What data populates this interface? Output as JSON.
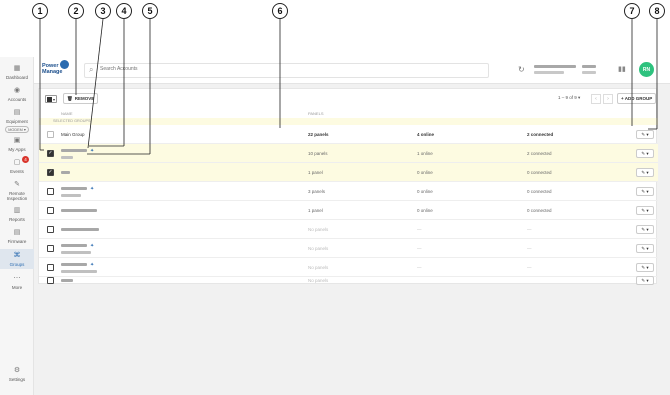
{
  "callouts": [
    "1",
    "2",
    "3",
    "4",
    "5",
    "6",
    "7",
    "8"
  ],
  "sidebar": {
    "items": [
      {
        "label": "Dashboard",
        "icon": "dashboard-icon",
        "glyph": "▦"
      },
      {
        "label": "Accounts",
        "icon": "accounts-icon",
        "glyph": "👥"
      },
      {
        "label": "Equipment",
        "icon": "equipment-icon",
        "glyph": "▤",
        "pill": "MODEM ▾"
      },
      {
        "label": "My Apps",
        "icon": "apps-icon",
        "glyph": "▣"
      },
      {
        "label": "Events",
        "icon": "events-icon",
        "glyph": "▢",
        "badge": "4"
      },
      {
        "label": "Remote Inspection",
        "icon": "wrench-icon",
        "glyph": "✎"
      },
      {
        "label": "Reports",
        "icon": "reports-icon",
        "glyph": "▥"
      },
      {
        "label": "Firmware",
        "icon": "firmware-icon",
        "glyph": "▤"
      },
      {
        "label": "Groups",
        "icon": "groups-icon",
        "glyph": "⌘",
        "active": true
      },
      {
        "label": "More",
        "icon": "more-icon",
        "glyph": "⋯"
      }
    ],
    "settings": "Settings"
  },
  "header": {
    "logo_line1": "Power",
    "logo_line2": "Manage",
    "search_placeholder": "Search Accounts",
    "avatar_initials": "RN"
  },
  "toolbar": {
    "remove_label": "REMOVE",
    "pager_text": "1 – 9 of 9 ▾",
    "add_group_label": "+ ADD GROUP"
  },
  "columns": {
    "name": "NAME",
    "panels": "PANELS"
  },
  "section_label": "SELECTED GROUPS",
  "rows": [
    {
      "name": "Main Group",
      "panels": "22 panels",
      "online": "4 online",
      "connected": "2 connected",
      "checked": false,
      "light": true,
      "selected": false
    },
    {
      "name": "",
      "panels": "10 panels",
      "online": "1 online",
      "connected": "2 connected",
      "checked": true,
      "selected": true,
      "blurred": true,
      "star": true,
      "sub": true
    },
    {
      "name": "",
      "panels": "1 panel",
      "online": "0 online",
      "connected": "0 connected",
      "checked": true,
      "selected": true,
      "blurred": true
    },
    {
      "name": "",
      "panels": "3 panels",
      "online": "0 online",
      "connected": "0 connected",
      "checked": false,
      "blurred": true,
      "star": true,
      "sub": true
    },
    {
      "name": "",
      "panels": "1 panel",
      "online": "0 online",
      "connected": "0 connected",
      "checked": false,
      "blurred": true
    },
    {
      "name": "",
      "panels": "No panels",
      "online": "—",
      "connected": "—",
      "checked": false,
      "blurred": true,
      "muted": true
    },
    {
      "name": "",
      "panels": "No panels",
      "online": "—",
      "connected": "—",
      "checked": false,
      "blurred": true,
      "star": true,
      "muted": true
    },
    {
      "name": "",
      "panels": "No panels",
      "online": "—",
      "connected": "—",
      "checked": false,
      "blurred": true,
      "star": true,
      "sub": true,
      "muted": true
    },
    {
      "name": "",
      "panels": "No panels",
      "online": "—",
      "connected": "—",
      "checked": false,
      "blurred": true,
      "muted": true
    }
  ],
  "row_action": "✎ ▾"
}
